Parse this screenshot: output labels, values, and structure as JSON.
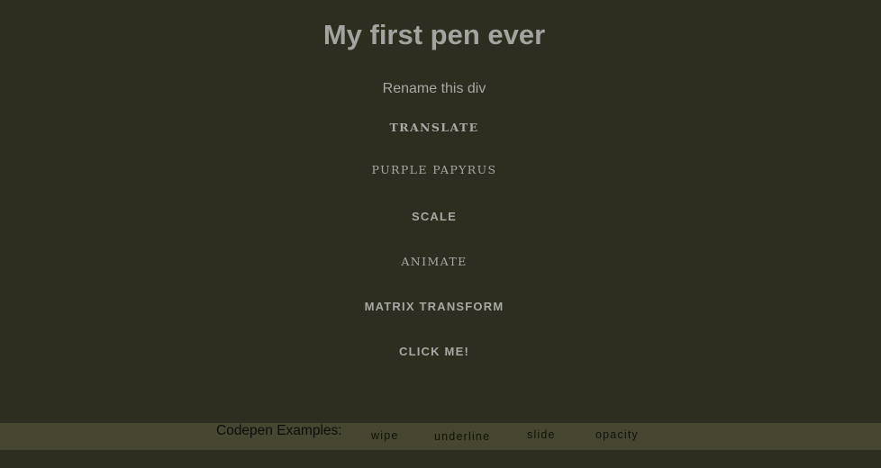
{
  "header": {
    "title": "My first pen ever",
    "subtitle": "Rename this div"
  },
  "effects": [
    {
      "label": "Translate"
    },
    {
      "label": "Purple Papyrus"
    },
    {
      "label": "Scale"
    },
    {
      "label": "Animate"
    },
    {
      "label": "Matrix Transform"
    },
    {
      "label": "Click me!"
    }
  ],
  "footer": {
    "label": "Codepen Examples:",
    "links": [
      {
        "label": "wipe"
      },
      {
        "label": "underline"
      },
      {
        "label": "slide"
      },
      {
        "label": "opacity"
      }
    ]
  },
  "colors": {
    "background": "#2d2d20",
    "footer_background": "#474731",
    "text": "#a8a8a4",
    "footer_text": "#0d0d0a"
  }
}
